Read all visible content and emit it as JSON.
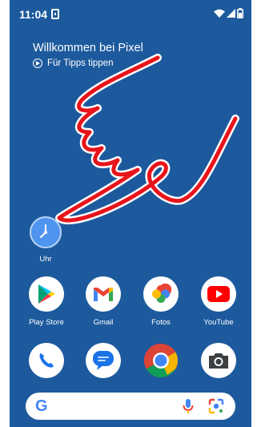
{
  "status": {
    "time": "11:04"
  },
  "home": {
    "welcome_title": "Willkommen bei Pixel",
    "tips_label": "Für Tipps tippen"
  },
  "widgets": {
    "clock_label": "Uhr"
  },
  "apps": [
    {
      "label": "Play Store",
      "icon": "play-store-icon"
    },
    {
      "label": "Gmail",
      "icon": "gmail-icon"
    },
    {
      "label": "Fotos",
      "icon": "photos-icon"
    },
    {
      "label": "YouTube",
      "icon": "youtube-icon"
    }
  ],
  "dock": [
    {
      "icon": "phone-icon"
    },
    {
      "icon": "messages-icon"
    },
    {
      "icon": "chrome-icon"
    },
    {
      "icon": "camera-icon"
    }
  ],
  "search": {
    "logo": "G"
  },
  "colors": {
    "wallpaper": "#1d5a9d",
    "scribble": "#e8141b"
  }
}
